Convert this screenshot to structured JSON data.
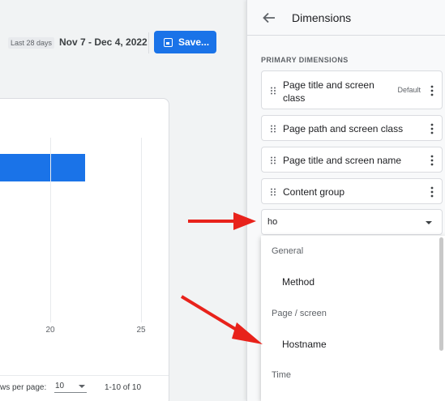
{
  "date_range": {
    "period_label": "Last 28 days",
    "dates": "Nov 7 - Dec 4, 2022"
  },
  "save_button": {
    "label": "Save...",
    "icon": "save-icon"
  },
  "chart": {
    "ticks": [
      "20",
      "25"
    ],
    "bar_color": "#1a73e8"
  },
  "pagination": {
    "rows_label": "ws per page:",
    "rows_value": "10",
    "range": "1-10 of 10"
  },
  "panel": {
    "title": "Dimensions",
    "section_label": "PRIMARY DIMENSIONS",
    "dimensions": [
      {
        "label": "Page title and screen class",
        "badge": "Default"
      },
      {
        "label": "Page path and screen class"
      },
      {
        "label": "Page title and screen name"
      },
      {
        "label": "Content group"
      }
    ],
    "search_value": "ho",
    "dropdown": {
      "groups": [
        {
          "name": "General",
          "options": [
            "Method"
          ]
        },
        {
          "name": "Page / screen",
          "options": [
            "Hostname"
          ]
        },
        {
          "name": "Time",
          "options": []
        }
      ]
    }
  },
  "colors": {
    "accent": "#1a73e8",
    "annotation_arrow": "#e8221b"
  }
}
